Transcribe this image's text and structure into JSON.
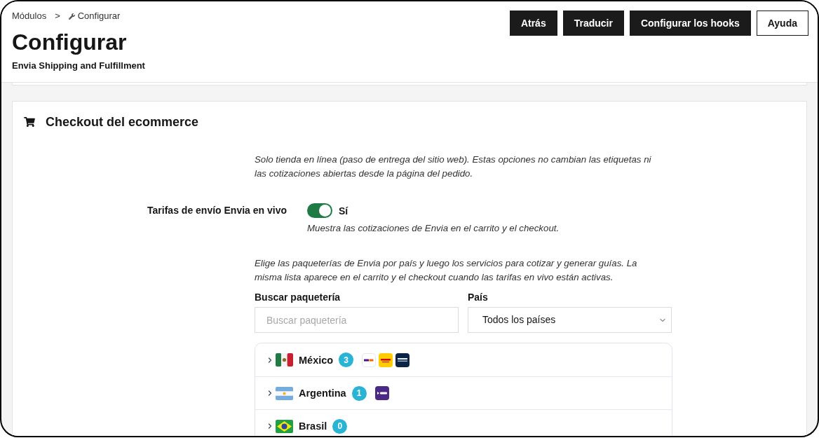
{
  "breadcrumb": {
    "items": [
      "Módulos",
      "Configurar"
    ],
    "separator": ">"
  },
  "header": {
    "title": "Configurar",
    "subtitle": "Envia Shipping and Fulfillment"
  },
  "toolbar": [
    {
      "label": "Atrás",
      "kind": "dark"
    },
    {
      "label": "Traducir",
      "kind": "dark"
    },
    {
      "label": "Configurar los hooks",
      "kind": "dark"
    },
    {
      "label": "Ayuda",
      "kind": "outline"
    }
  ],
  "section": {
    "title": "Checkout del ecommerce",
    "intro": "Solo tienda en línea (paso de entrega del sitio web). Estas opciones no cambian las etiquetas ni las cotizaciones abiertas desde la página del pedido.",
    "live_rates": {
      "label": "Tarifas de envío Envia en vivo",
      "on": true,
      "state_label": "Sí",
      "help": "Muestra las cotizaciones de Envia en el carrito y el checkout."
    },
    "carriers_intro": "Elige las paqueterías de Envia por país y luego los servicios para cotizar y generar guías. La misma lista aparece en el carrito y el checkout cuando las tarifas en vivo están activas.",
    "search": {
      "label": "Buscar paquetería",
      "placeholder": "Buscar paquetería"
    },
    "country_filter": {
      "label": "País",
      "value": "Todos los países"
    },
    "countries": [
      {
        "name": "México",
        "kind": "mx",
        "count": "3",
        "expanded": false,
        "carriers": [
          {
            "kind": "fedex"
          },
          {
            "kind": "dhl"
          },
          {
            "kind": "dark"
          }
        ]
      },
      {
        "name": "Argentina",
        "kind": "ar",
        "count": "1",
        "expanded": false,
        "carriers": [
          {
            "kind": "oca"
          }
        ]
      },
      {
        "name": "Brasil",
        "kind": "br",
        "count": "0",
        "expanded": false
      }
    ]
  }
}
